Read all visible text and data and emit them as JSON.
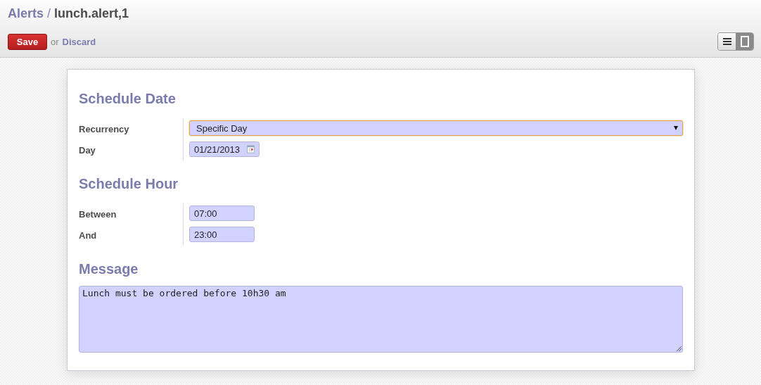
{
  "breadcrumb": {
    "parent": "Alerts",
    "separator": "/",
    "current": "lunch.alert,1"
  },
  "actions": {
    "save": "Save",
    "or": "or",
    "discard": "Discard"
  },
  "view_modes": [
    {
      "kind": "list",
      "selected": false
    },
    {
      "kind": "form",
      "selected": true
    }
  ],
  "sections": [
    {
      "title": "Schedule Date",
      "fields": [
        {
          "label": "Recurrency",
          "kind": "select",
          "value": "Specific Day",
          "focused": true
        },
        {
          "label": "Day",
          "kind": "date",
          "value": "01/21/2013",
          "focused": false
        }
      ]
    },
    {
      "title": "Schedule Hour",
      "fields": [
        {
          "label": "Between",
          "kind": "text",
          "value": "07:00",
          "focused": false
        },
        {
          "label": "And",
          "kind": "text",
          "value": "23:00",
          "focused": false
        }
      ]
    }
  ],
  "message": {
    "title": "Message",
    "value": "Lunch must be ordered before 10h30 am"
  }
}
